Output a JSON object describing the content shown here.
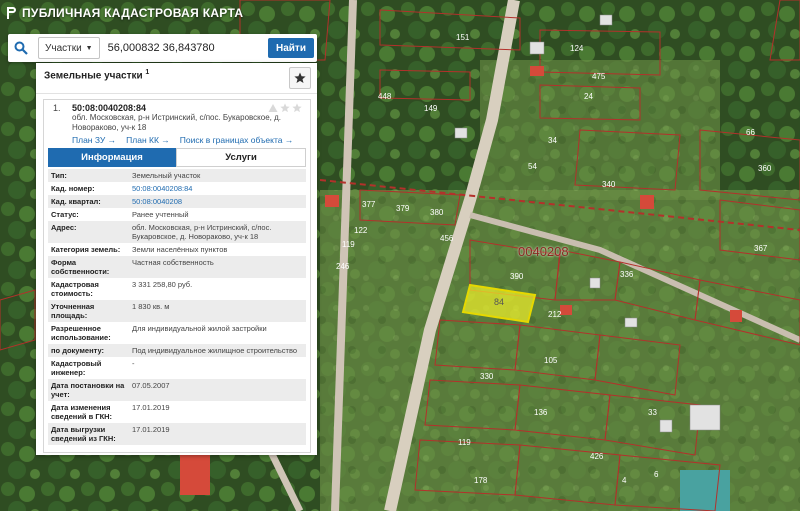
{
  "app": {
    "title": "ПУБЛИЧНАЯ КАДАСТРОВАЯ КАРТА",
    "logo_icon": "pkk-logo-icon"
  },
  "search": {
    "type_label": "Участки",
    "query": "56,000832 36,843780",
    "button_label": "Найти"
  },
  "panel": {
    "title": "Земельные участки",
    "title_note": "1"
  },
  "result": {
    "index": "1.",
    "cad_number": "50:08:0040208:84",
    "address": "обл. Московская, р-н Истринский, с/пос. Букаровское, д. Новораково, уч-к 18",
    "links": {
      "plan_zu": "План ЗУ →",
      "plan_kk": "План КК →",
      "search_bounds": "Поиск в границах объекта →"
    },
    "tabs": {
      "info": "Информация",
      "services": "Услуги"
    },
    "rows": [
      {
        "label": "Тип:",
        "value": "Земельный участок"
      },
      {
        "label": "Кад. номер:",
        "value": "50:08:0040208:84"
      },
      {
        "label": "Кад. квартал:",
        "value": "50:08:0040208"
      },
      {
        "label": "Статус:",
        "value": "Ранее учтенный"
      },
      {
        "label": "Адрес:",
        "value": "обл. Московская, р-н Истринский, с/пос. Букаровское, д. Новораково, уч-к 18"
      },
      {
        "label": "Категория земель:",
        "value": "Земли населённых пунктов"
      },
      {
        "label": "Форма собственности:",
        "value": "Частная собственность"
      },
      {
        "label": "Кадастровая стоимость:",
        "value": "3 331 258,80 руб."
      },
      {
        "label": "Уточненная площадь:",
        "value": "1 830 кв. м"
      },
      {
        "label": "Разрешенное использование:",
        "value": "Для индивидуальной жилой застройки"
      },
      {
        "label": "по документу:",
        "value": "Под индивидуальное жилищное строительство"
      },
      {
        "label": "Кадастровый инженер:",
        "value": "-"
      },
      {
        "label": "Дата постановки на учет:",
        "value": "07.05.2007"
      },
      {
        "label": "Дата изменения сведений в ГКН:",
        "value": "17.01.2019"
      },
      {
        "label": "Дата выгрузки сведений из ГКН:",
        "value": "17.01.2019"
      }
    ]
  },
  "map": {
    "quarter_label": "0040208",
    "selected_parcel_label": "84",
    "parcel_numbers": [
      "151",
      "124",
      "475",
      "448",
      "149",
      "24",
      "34",
      "54",
      "340",
      "377",
      "379",
      "380",
      "122",
      "119",
      "456",
      "246",
      "390",
      "212",
      "336",
      "66",
      "360",
      "367",
      "105",
      "136",
      "33",
      "330",
      "119",
      "178",
      "426",
      "4",
      "6"
    ]
  },
  "colors": {
    "accent": "#1f6bb0",
    "parcel_border": "#b3312b",
    "selected_fill": "#f2f22a"
  }
}
